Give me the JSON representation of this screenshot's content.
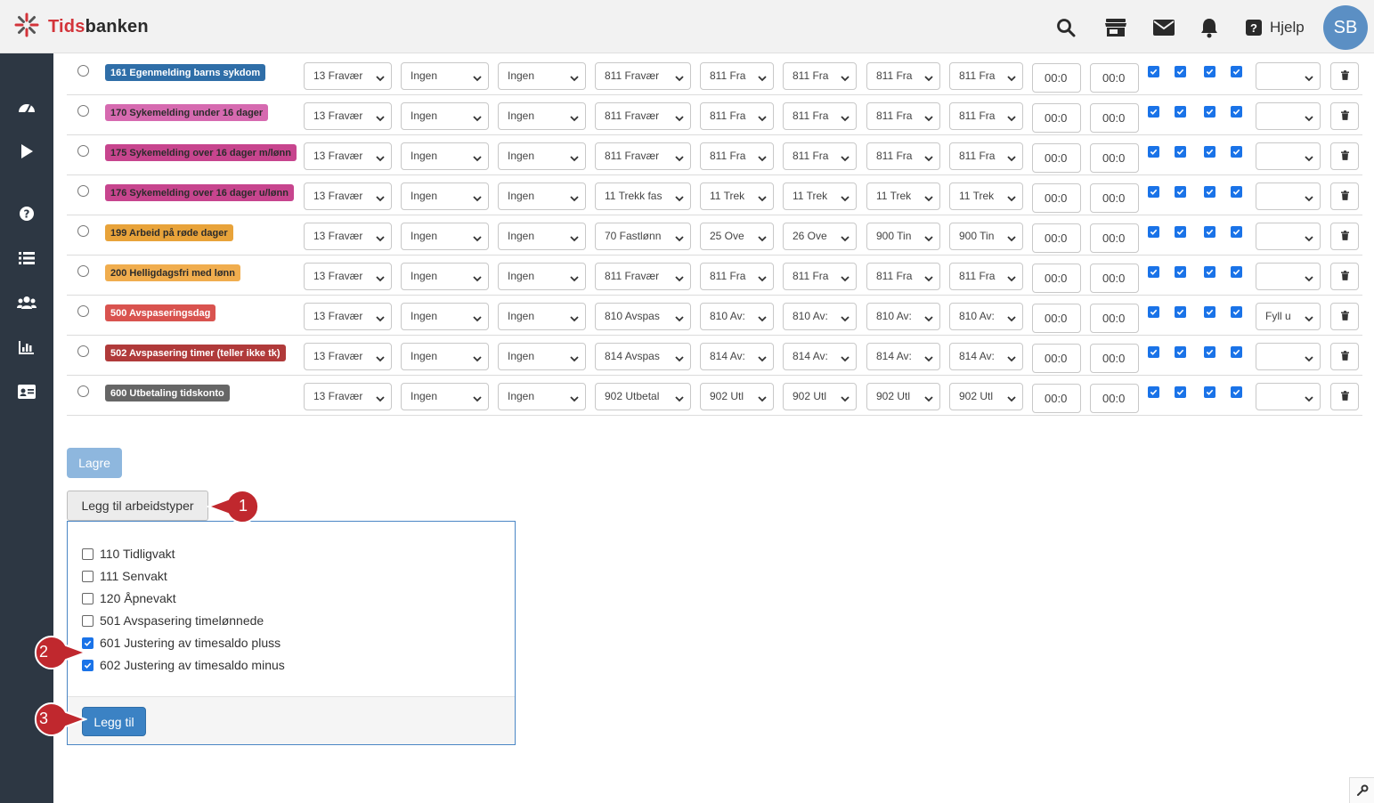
{
  "header": {
    "logo_text_accent": "Tids",
    "logo_text_rest": "banken",
    "help_label": "Hjelp",
    "avatar_initials": "SB",
    "icons": [
      "search-icon",
      "store-icon",
      "mail-icon",
      "bell-icon",
      "help-icon"
    ]
  },
  "sidebar": {
    "icons": [
      "dashboard-icon",
      "play-icon",
      "question-icon",
      "list-icon",
      "users-icon",
      "chart-icon",
      "id-card-icon"
    ]
  },
  "rows": [
    {
      "label": "161 Egenmelding barns sykdom",
      "badge_color": "#2f6ea8",
      "badge_text_color": "#ffffff",
      "s1": "13 Fravær",
      "s2": "Ingen",
      "s3": "Ingen",
      "s4": "811 Fravær",
      "s5": "811 Fra",
      "s6": "811 Fra",
      "s7": "811 Fra",
      "s8": "811 Fra",
      "t1": "00:0",
      "t2": "00:0",
      "last": ""
    },
    {
      "label": "170 Sykemelding under 16 dager",
      "badge_color": "#d66ab0",
      "badge_text_color": "#2b2b2b",
      "s1": "13 Fravær",
      "s2": "Ingen",
      "s3": "Ingen",
      "s4": "811 Fravær",
      "s5": "811 Fra",
      "s6": "811 Fra",
      "s7": "811 Fra",
      "s8": "811 Fra",
      "t1": "00:0",
      "t2": "00:0",
      "last": ""
    },
    {
      "label": "175 Sykemelding over 16 dager m/lønn",
      "badge_color": "#c7458e",
      "badge_text_color": "#2b2b2b",
      "s1": "13 Fravær",
      "s2": "Ingen",
      "s3": "Ingen",
      "s4": "811 Fravær",
      "s5": "811 Fra",
      "s6": "811 Fra",
      "s7": "811 Fra",
      "s8": "811 Fra",
      "t1": "00:0",
      "t2": "00:0",
      "last": ""
    },
    {
      "label": "176 Sykemelding over 16 dager u/lønn",
      "badge_color": "#c7458e",
      "badge_text_color": "#2b2b2b",
      "s1": "13 Fravær",
      "s2": "Ingen",
      "s3": "Ingen",
      "s4": "11 Trekk fas",
      "s5": "11 Trek",
      "s6": "11 Trek",
      "s7": "11 Trek",
      "s8": "11 Trek",
      "t1": "00:0",
      "t2": "00:0",
      "last": ""
    },
    {
      "label": "199 Arbeid på røde dager",
      "badge_color": "#e8a33a",
      "badge_text_color": "#2b2b2b",
      "s1": "13 Fravær",
      "s2": "Ingen",
      "s3": "Ingen",
      "s4": "70 Fastlønn",
      "s5": "25 Ove",
      "s6": "26 Ove",
      "s7": "900 Tin",
      "s8": "900 Tin",
      "t1": "00:0",
      "t2": "00:0",
      "last": ""
    },
    {
      "label": "200 Helligdagsfri med lønn",
      "badge_color": "#f0ad4e",
      "badge_text_color": "#2b2b2b",
      "s1": "13 Fravær",
      "s2": "Ingen",
      "s3": "Ingen",
      "s4": "811 Fravær",
      "s5": "811 Fra",
      "s6": "811 Fra",
      "s7": "811 Fra",
      "s8": "811 Fra",
      "t1": "00:0",
      "t2": "00:0",
      "last": ""
    },
    {
      "label": "500 Avspaseringsdag",
      "badge_color": "#d9534f",
      "badge_text_color": "#ffffff",
      "s1": "13 Fravær",
      "s2": "Ingen",
      "s3": "Ingen",
      "s4": "810 Avspas",
      "s5": "810 Av:",
      "s6": "810 Av:",
      "s7": "810 Av:",
      "s8": "810 Av:",
      "t1": "00:0",
      "t2": "00:0",
      "last": "Fyll u"
    },
    {
      "label": "502 Avspasering timer (teller ikke tk)",
      "badge_color": "#b03a3a",
      "badge_text_color": "#ffffff",
      "s1": "13 Fravær",
      "s2": "Ingen",
      "s3": "Ingen",
      "s4": "814 Avspas",
      "s5": "814 Av:",
      "s6": "814 Av:",
      "s7": "814 Av:",
      "s8": "814 Av:",
      "t1": "00:0",
      "t2": "00:0",
      "last": ""
    },
    {
      "label": "600 Utbetaling tidskonto",
      "badge_color": "#666666",
      "badge_text_color": "#ffffff",
      "s1": "13 Fravær",
      "s2": "Ingen",
      "s3": "Ingen",
      "s4": "902 Utbetal",
      "s5": "902 Utl",
      "s6": "902 Utl",
      "s7": "902 Utl",
      "s8": "902 Utl",
      "t1": "00:0",
      "t2": "00:0",
      "last": ""
    }
  ],
  "actions": {
    "save_label": "Lagre",
    "add_types_label": "Legg til arbeidstyper",
    "add_label": "Legg til"
  },
  "work_types": [
    {
      "label": "110 Tidligvakt",
      "checked": false
    },
    {
      "label": "111 Senvakt",
      "checked": false
    },
    {
      "label": "120 Åpnevakt",
      "checked": false
    },
    {
      "label": "501 Avspasering timelønnede",
      "checked": false
    },
    {
      "label": "601 Justering av timesaldo pluss",
      "checked": true
    },
    {
      "label": "602 Justering av timesaldo minus",
      "checked": true
    }
  ],
  "callouts": [
    "1",
    "2",
    "3"
  ],
  "colors": {
    "topbar": "#f2f2f2",
    "sidebar": "#2d3743",
    "accent_blue": "#3b82c4",
    "checkbox_blue": "#1a73e8",
    "callout_red": "#c0282e",
    "logo_red": "#d3343a"
  }
}
